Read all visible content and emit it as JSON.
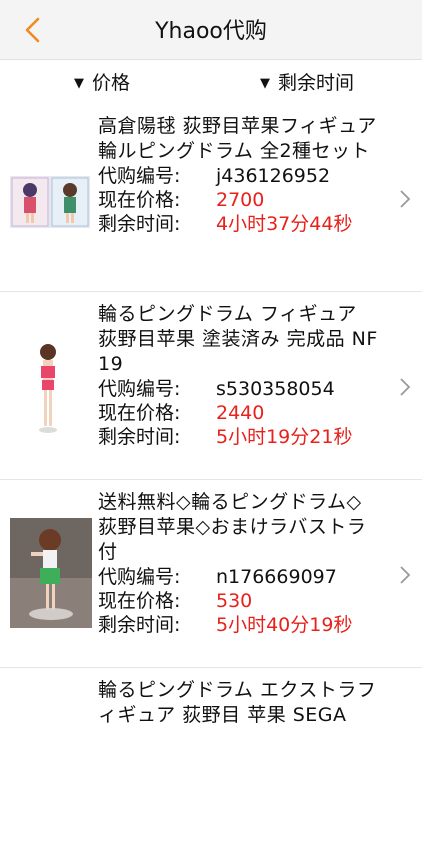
{
  "header": {
    "title": "Yhaoo代购"
  },
  "sort": {
    "price_label": "价格",
    "time_label": "剩余时间"
  },
  "labels": {
    "code": "代购编号:",
    "price": "现在价格:",
    "remain": "剩余时间:"
  },
  "colors": {
    "accent": "#f08a24",
    "price": "#e8211b"
  },
  "items": [
    {
      "name": "高倉陽毬 荻野目苹果フィギュア 輪ルピングドラム 全2種セット",
      "code": "j436126952",
      "price": "2700",
      "remain": "4小时37分44秒"
    },
    {
      "name": "輪るピングドラム フィギュア 荻野目苹果 塗装済み 完成品 NF19",
      "code": "s530358054",
      "price": "2440",
      "remain": "5小时19分21秒"
    },
    {
      "name": "送料無料◇輪るピングドラム◇荻野目苹果◇おまけラバストラ付",
      "code": "n176669097",
      "price": "530",
      "remain": "5小时40分19秒"
    },
    {
      "name": "輪るピングドラム エクストラフィギュア 荻野目 苹果 SEGA"
    }
  ]
}
